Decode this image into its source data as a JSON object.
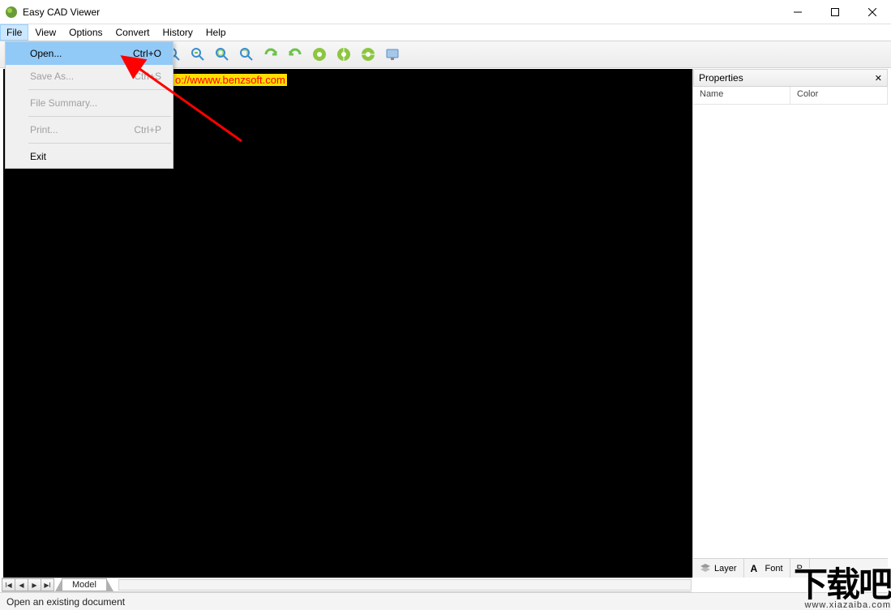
{
  "titlebar": {
    "title": "Easy CAD Viewer"
  },
  "menubar": {
    "items": [
      "File",
      "View",
      "Options",
      "Convert",
      "History",
      "Help"
    ]
  },
  "file_menu": {
    "open": {
      "label": "Open...",
      "shortcut": "Ctrl+O"
    },
    "save_as": {
      "label": "Save As...",
      "shortcut": "Ctrl+S"
    },
    "file_summary": {
      "label": "File Summary..."
    },
    "print": {
      "label": "Print...",
      "shortcut": "Ctrl+P"
    },
    "exit": {
      "label": "Exit"
    }
  },
  "url_banner": "o://wwww.benzsoft.com",
  "properties": {
    "title": "Properties",
    "col_name": "Name",
    "col_color": "Color",
    "tab_layer": "Layer",
    "tab_font": "Font",
    "extra_letter": "P"
  },
  "sheets": {
    "model": "Model"
  },
  "statusbar": {
    "message": "Open an existing document"
  },
  "watermark": {
    "big": "下载吧",
    "small": "www.xiazaiba.com"
  }
}
